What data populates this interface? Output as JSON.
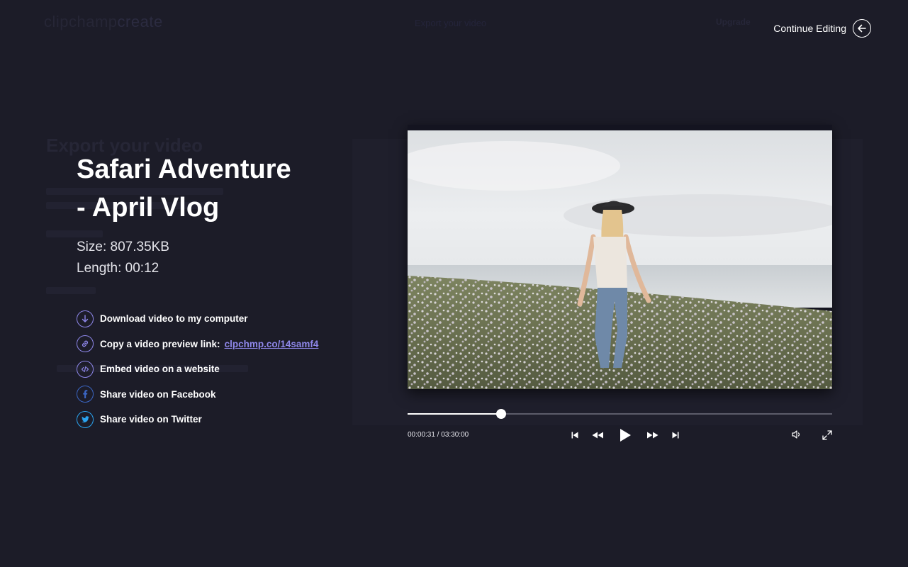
{
  "background_app": {
    "logo_text": "clipchamp",
    "logo_accent": "create",
    "center_title": "Export your video",
    "upgrade_label": "Upgrade",
    "heading": "Export your video"
  },
  "header": {
    "continue_label": "Continue Editing"
  },
  "video_info": {
    "title_line1": "Safari Adventure",
    "title_line2": "- April Vlog",
    "size_text": "Size: 807.35KB",
    "length_text": "Length: 00:12"
  },
  "actions": [
    {
      "label": "Download video to my computer",
      "icon": "download-icon"
    },
    {
      "label": "Copy a video preview link:",
      "link": "clpchmp.co/14samf4",
      "icon": "link-icon"
    },
    {
      "label": "Embed video on a website",
      "icon": "code-icon"
    },
    {
      "label": "Share video on Facebook",
      "icon": "facebook-icon"
    },
    {
      "label": "Share video on Twitter",
      "icon": "twitter-icon"
    }
  ],
  "player": {
    "current_time": "00:00:31",
    "total_time": "03:30:00",
    "time_separator": " / ",
    "progress_fraction": 0.22
  },
  "colors": {
    "background": "#1c1c28",
    "accent": "#8e87ea",
    "facebook": "#3b66c4",
    "twitter": "#2aa3ef"
  }
}
